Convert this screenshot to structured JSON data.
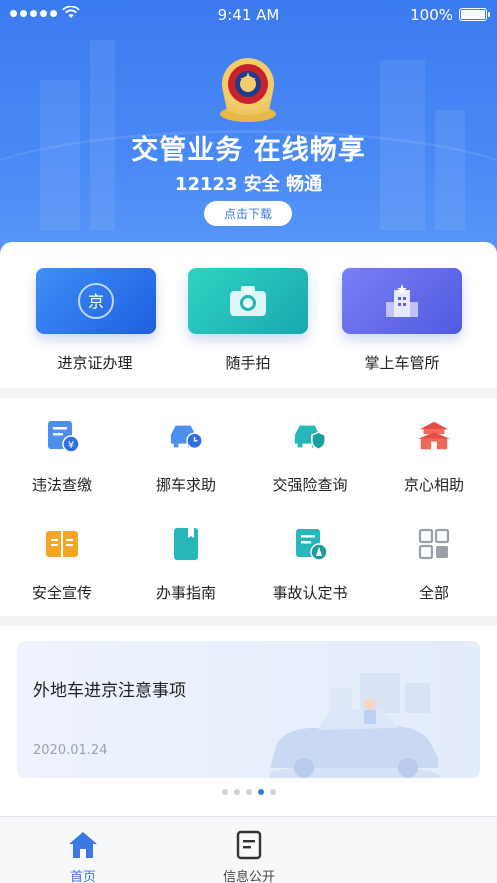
{
  "status_bar": {
    "time": "9:41 AM",
    "battery": "100%"
  },
  "hero": {
    "title": "交管业务 在线畅享",
    "subtitle": "12123 安全 畅通",
    "download_button": "点击下载"
  },
  "quick_services": [
    {
      "label": "进京证办理",
      "icon": "jing-badge-icon"
    },
    {
      "label": "随手拍",
      "icon": "camera-icon"
    },
    {
      "label": "掌上车管所",
      "icon": "building-icon"
    }
  ],
  "services": [
    {
      "label": "违法查缴",
      "icon": "fine-payment-icon"
    },
    {
      "label": "挪车求助",
      "icon": "car-clock-icon"
    },
    {
      "label": "交强险查询",
      "icon": "car-shield-icon"
    },
    {
      "label": "京心相助",
      "icon": "tiananmen-icon"
    },
    {
      "label": "安全宣传",
      "icon": "book-icon"
    },
    {
      "label": "办事指南",
      "icon": "bookmark-icon"
    },
    {
      "label": "事故认定书",
      "icon": "document-cone-icon"
    },
    {
      "label": "全部",
      "icon": "grid-icon"
    }
  ],
  "news": {
    "title": "外地车进京注意事项",
    "date": "2020.01.24",
    "active_slide": 4,
    "slide_count": 5
  },
  "tabs": [
    {
      "label": "首页",
      "icon": "home-icon",
      "active": true
    },
    {
      "label": "信息公开",
      "icon": "document-icon",
      "active": false
    }
  ],
  "colors": {
    "accent": "#3b78e6",
    "hero": "#4a8af6"
  }
}
